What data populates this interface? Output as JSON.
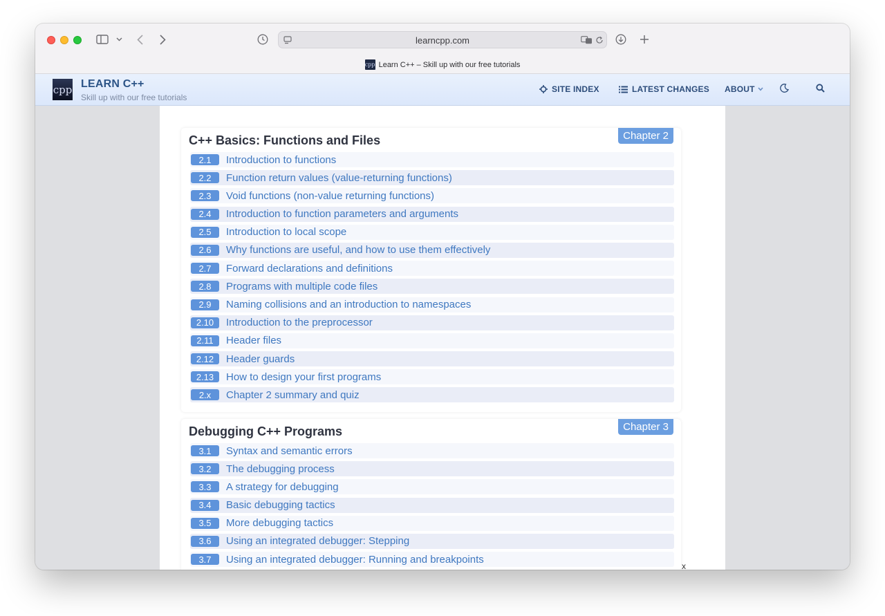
{
  "browser": {
    "url": "learncpp.com",
    "tab_title": "Learn C++ – Skill up with our free tutorials",
    "favicon_text": "cpp"
  },
  "site": {
    "logo_text": "cpp",
    "title": "LEARN C++",
    "tagline": "Skill up with our free tutorials",
    "nav": {
      "site_index": "SITE INDEX",
      "latest_changes": "LATEST CHANGES",
      "about": "ABOUT"
    }
  },
  "chapters": [
    {
      "badge": "Chapter 2",
      "title": "C++ Basics: Functions and Files",
      "lessons": [
        {
          "num": "2.1",
          "title": "Introduction to functions"
        },
        {
          "num": "2.2",
          "title": "Function return values (value-returning functions)"
        },
        {
          "num": "2.3",
          "title": "Void functions (non-value returning functions)"
        },
        {
          "num": "2.4",
          "title": "Introduction to function parameters and arguments"
        },
        {
          "num": "2.5",
          "title": "Introduction to local scope"
        },
        {
          "num": "2.6",
          "title": "Why functions are useful, and how to use them effectively"
        },
        {
          "num": "2.7",
          "title": "Forward declarations and definitions"
        },
        {
          "num": "2.8",
          "title": "Programs with multiple code files"
        },
        {
          "num": "2.9",
          "title": "Naming collisions and an introduction to namespaces"
        },
        {
          "num": "2.10",
          "title": "Introduction to the preprocessor"
        },
        {
          "num": "2.11",
          "title": "Header files"
        },
        {
          "num": "2.12",
          "title": "Header guards"
        },
        {
          "num": "2.13",
          "title": "How to design your first programs"
        },
        {
          "num": "2.x",
          "title": "Chapter 2 summary and quiz"
        }
      ]
    },
    {
      "badge": "Chapter 3",
      "title": "Debugging C++ Programs",
      "lessons": [
        {
          "num": "3.1",
          "title": "Syntax and semantic errors"
        },
        {
          "num": "3.2",
          "title": "The debugging process"
        },
        {
          "num": "3.3",
          "title": "A strategy for debugging"
        },
        {
          "num": "3.4",
          "title": "Basic debugging tactics"
        },
        {
          "num": "3.5",
          "title": "More debugging tactics"
        },
        {
          "num": "3.6",
          "title": "Using an integrated debugger: Stepping"
        },
        {
          "num": "3.7",
          "title": "Using an integrated debugger: Running and breakpoints"
        }
      ]
    }
  ],
  "close_label": "x"
}
